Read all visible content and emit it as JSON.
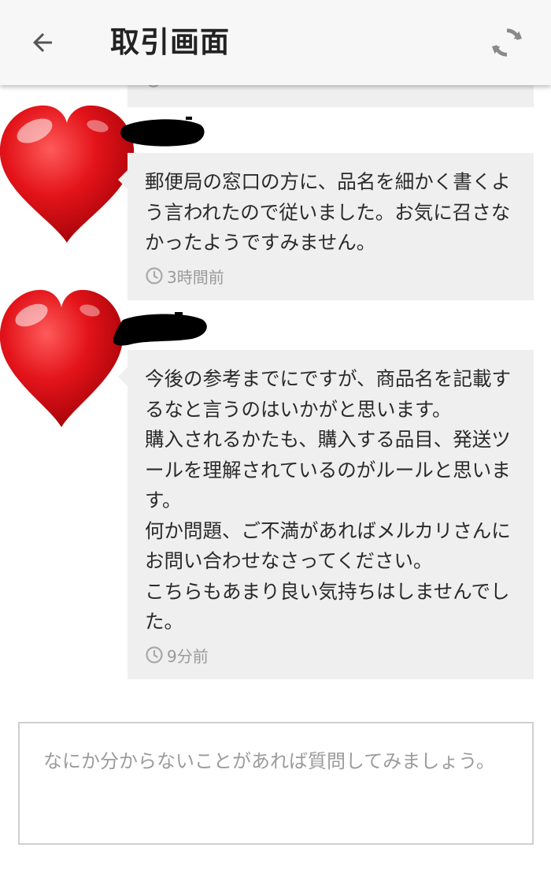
{
  "header": {
    "title": "取引画面",
    "back_icon": "arrow-left-icon",
    "refresh_icon": "refresh-icon"
  },
  "messages": [
    {
      "avatar": "heart",
      "text": "郵便局の窓口の方に、品名を細かく書くよう言われたので従いました。お気に召さなかったようですみません。",
      "time": "3時間前"
    },
    {
      "avatar": "heart",
      "text": "今後の参考までにですが、商品名を記載するなと言うのはいかがと思います。\n購入されるかたも、購入する品目、発送ツールを理解されているのがルールと思います。\n何か問題、ご不満があればメルカリさんにお問い合わせなさってください。\nこちらもあまり良い気持ちはしませんでした。",
      "time": "9分前"
    }
  ],
  "input": {
    "placeholder": "なにか分からないことがあれば質問してみましょう。",
    "value": ""
  },
  "colors": {
    "header_bg": "#f7f7f7",
    "bubble_bg": "#efefef",
    "text": "#2a2a2a",
    "meta_text": "#9a9a9a",
    "heart_red": "#e0151b"
  }
}
